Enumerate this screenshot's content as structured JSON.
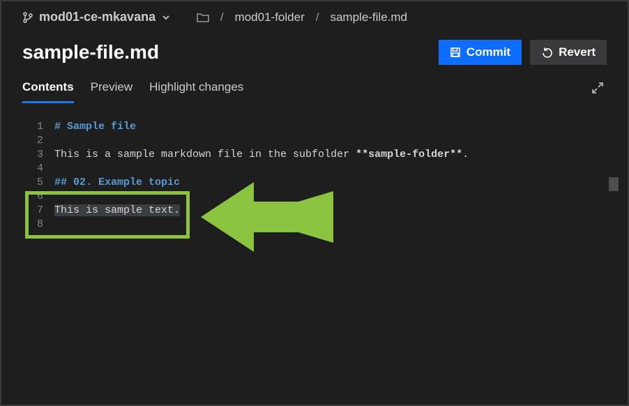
{
  "breadcrumb": {
    "branch": "mod01-ce-mkavana",
    "folder": "mod01-folder",
    "file": "sample-file.md"
  },
  "page_title": "sample-file.md",
  "actions": {
    "commit": "Commit",
    "revert": "Revert"
  },
  "tabs": {
    "contents": "Contents",
    "preview": "Preview",
    "highlight_changes": "Highlight changes"
  },
  "colors": {
    "primary": "#0d6efd",
    "heading": "#569cd6",
    "annotation": "#8bc53f"
  },
  "editor_lines": [
    {
      "num": "1",
      "type": "heading",
      "text": "# Sample file"
    },
    {
      "num": "2",
      "type": "blank",
      "text": ""
    },
    {
      "num": "3",
      "type": "text",
      "text_before": "This is a sample markdown file in the subfolder ",
      "bold": "**sample-folder**",
      "text_after": "."
    },
    {
      "num": "4",
      "type": "blank",
      "text": ""
    },
    {
      "num": "5",
      "type": "heading",
      "text": "## 02. Example topic"
    },
    {
      "num": "6",
      "type": "blank",
      "text": ""
    },
    {
      "num": "7",
      "type": "selected",
      "text": "This is sample text."
    },
    {
      "num": "8",
      "type": "blank",
      "text": ""
    }
  ]
}
